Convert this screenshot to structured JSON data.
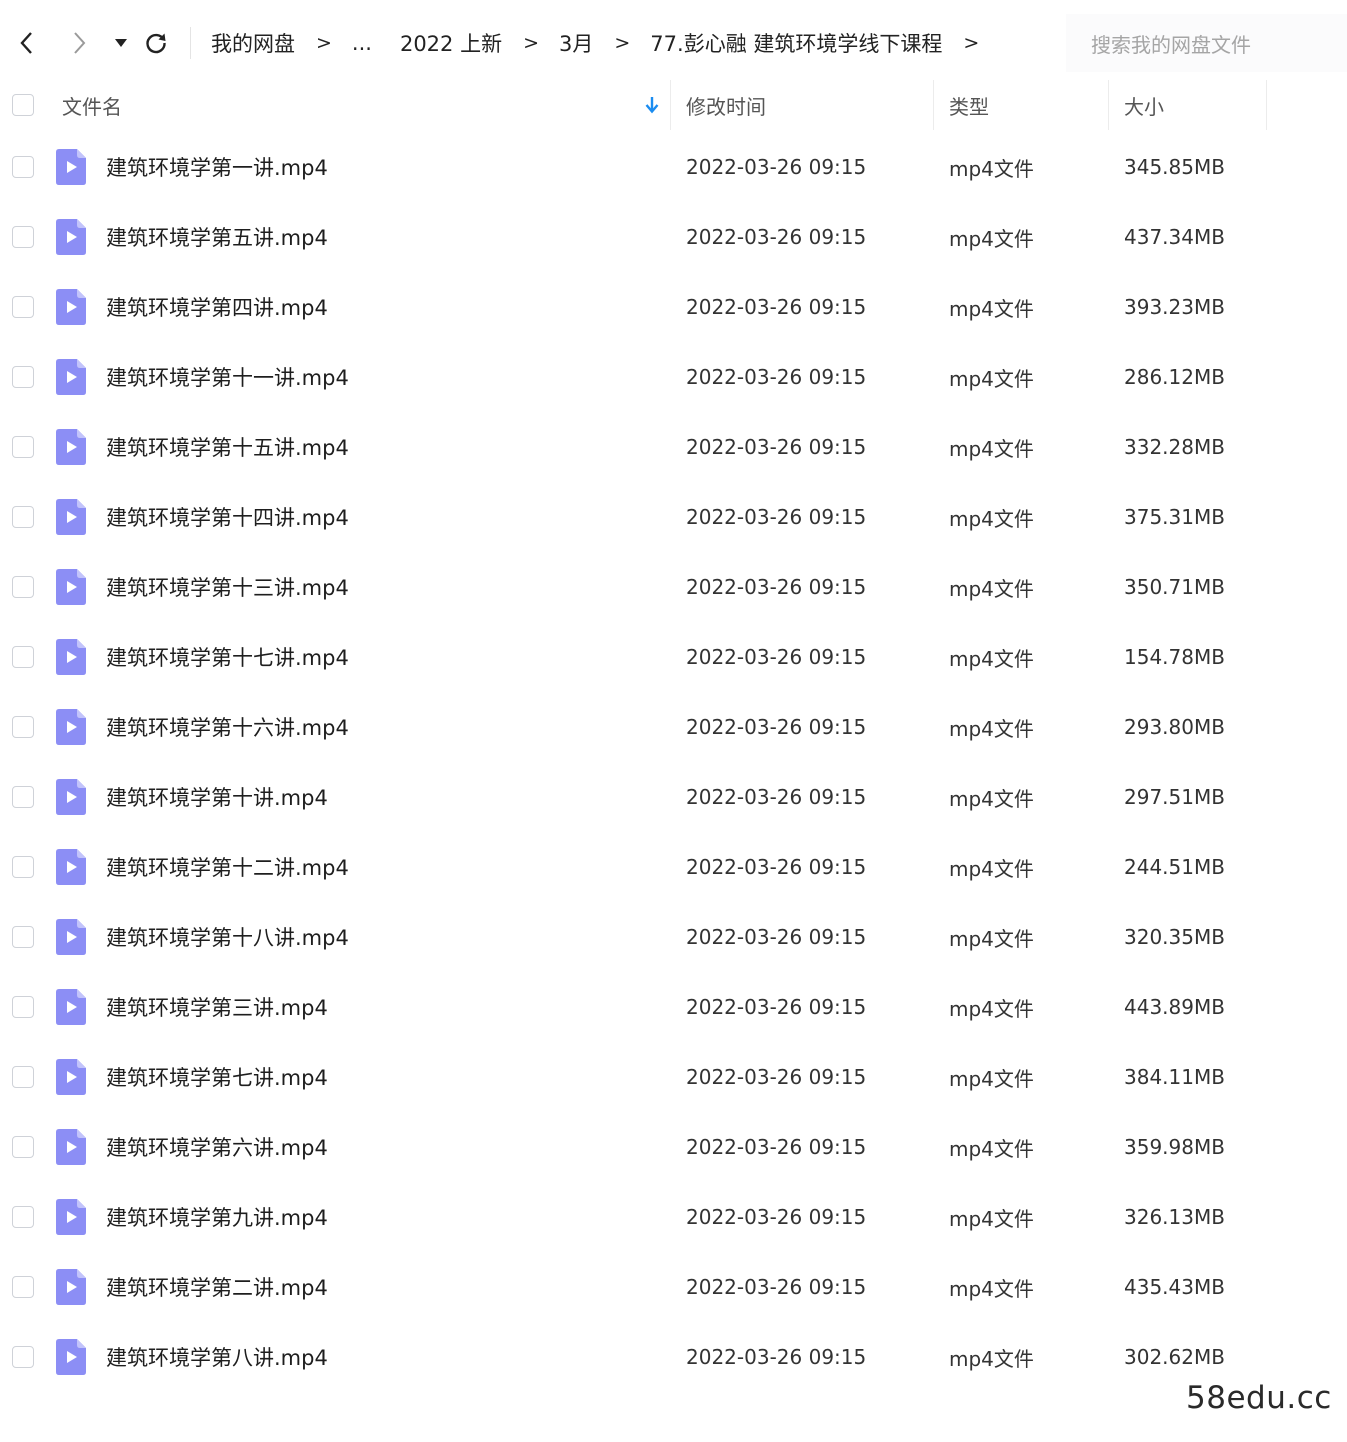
{
  "toolbar": {
    "back_label": "<",
    "forward_label": ">",
    "breadcrumb": [
      {
        "label": "我的网盘"
      },
      {
        "label": "..."
      },
      {
        "label": "2022 上新"
      },
      {
        "label": "3月"
      },
      {
        "label": "77.彭心融 建筑环境学线下课程"
      }
    ],
    "separator": ">",
    "search_placeholder": "搜索我的网盘文件"
  },
  "header": {
    "name": "文件名",
    "modified": "修改时间",
    "type": "类型",
    "size": "大小",
    "sort_icon": "sort-down-arrow-icon"
  },
  "colors": {
    "accent": "#1a8cf0",
    "file_icon": "#8c8ef5",
    "file_icon_fold": "#c2c3fb"
  },
  "files": [
    {
      "name": "建筑环境学第一讲.mp4",
      "modified": "2022-03-26 09:15",
      "type": "mp4文件",
      "size": "345.85MB"
    },
    {
      "name": "建筑环境学第五讲.mp4",
      "modified": "2022-03-26 09:15",
      "type": "mp4文件",
      "size": "437.34MB"
    },
    {
      "name": "建筑环境学第四讲.mp4",
      "modified": "2022-03-26 09:15",
      "type": "mp4文件",
      "size": "393.23MB"
    },
    {
      "name": "建筑环境学第十一讲.mp4",
      "modified": "2022-03-26 09:15",
      "type": "mp4文件",
      "size": "286.12MB"
    },
    {
      "name": "建筑环境学第十五讲.mp4",
      "modified": "2022-03-26 09:15",
      "type": "mp4文件",
      "size": "332.28MB"
    },
    {
      "name": "建筑环境学第十四讲.mp4",
      "modified": "2022-03-26 09:15",
      "type": "mp4文件",
      "size": "375.31MB"
    },
    {
      "name": "建筑环境学第十三讲.mp4",
      "modified": "2022-03-26 09:15",
      "type": "mp4文件",
      "size": "350.71MB"
    },
    {
      "name": "建筑环境学第十七讲.mp4",
      "modified": "2022-03-26 09:15",
      "type": "mp4文件",
      "size": "154.78MB"
    },
    {
      "name": "建筑环境学第十六讲.mp4",
      "modified": "2022-03-26 09:15",
      "type": "mp4文件",
      "size": "293.80MB"
    },
    {
      "name": "建筑环境学第十讲.mp4",
      "modified": "2022-03-26 09:15",
      "type": "mp4文件",
      "size": "297.51MB"
    },
    {
      "name": "建筑环境学第十二讲.mp4",
      "modified": "2022-03-26 09:15",
      "type": "mp4文件",
      "size": "244.51MB"
    },
    {
      "name": "建筑环境学第十八讲.mp4",
      "modified": "2022-03-26 09:15",
      "type": "mp4文件",
      "size": "320.35MB"
    },
    {
      "name": "建筑环境学第三讲.mp4",
      "modified": "2022-03-26 09:15",
      "type": "mp4文件",
      "size": "443.89MB"
    },
    {
      "name": "建筑环境学第七讲.mp4",
      "modified": "2022-03-26 09:15",
      "type": "mp4文件",
      "size": "384.11MB"
    },
    {
      "name": "建筑环境学第六讲.mp4",
      "modified": "2022-03-26 09:15",
      "type": "mp4文件",
      "size": "359.98MB"
    },
    {
      "name": "建筑环境学第九讲.mp4",
      "modified": "2022-03-26 09:15",
      "type": "mp4文件",
      "size": "326.13MB"
    },
    {
      "name": "建筑环境学第二讲.mp4",
      "modified": "2022-03-26 09:15",
      "type": "mp4文件",
      "size": "435.43MB"
    },
    {
      "name": "建筑环境学第八讲.mp4",
      "modified": "2022-03-26 09:15",
      "type": "mp4文件",
      "size": "302.62MB"
    }
  ],
  "watermark": "58edu.cc"
}
